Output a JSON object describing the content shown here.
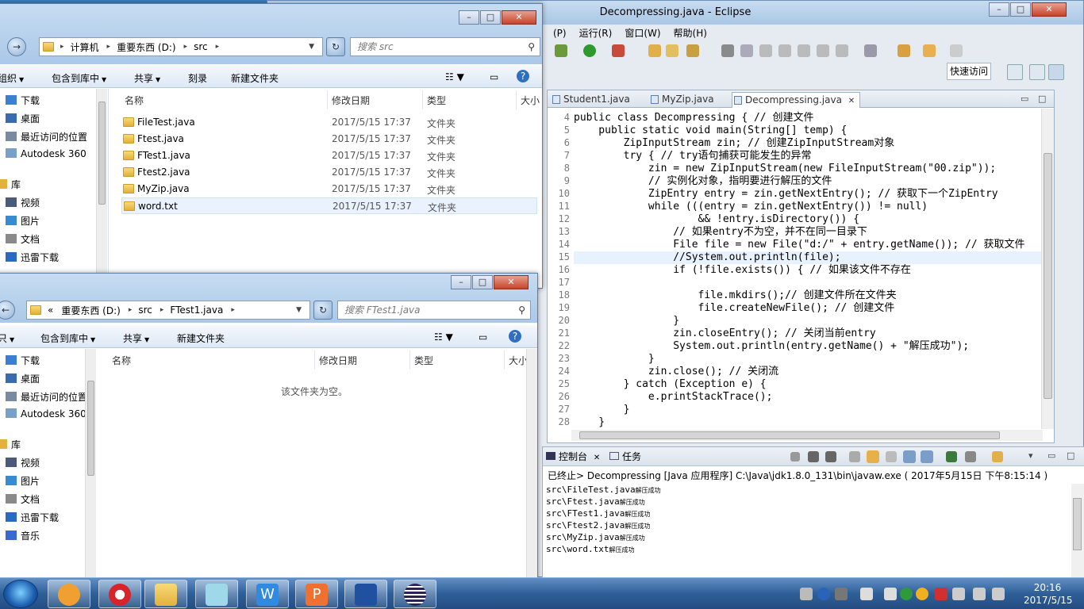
{
  "eclipse": {
    "title": "Decompressing.java - Eclipse",
    "menu": [
      "(P)",
      "运行(R)",
      "窗口(W)",
      "帮助(H)"
    ],
    "quick_access": "快速访问",
    "editor_tabs": [
      "Student1.java",
      "MyZip.java",
      "Decompressing.java"
    ],
    "line_numbers": [
      "4",
      "5",
      "6",
      "7",
      "8",
      "9",
      "10",
      "11",
      "12",
      "13",
      "14",
      "15",
      "16",
      "17",
      "18",
      "19",
      "20",
      "21",
      "22",
      "23",
      "24",
      "25",
      "26",
      "27",
      "28"
    ],
    "code_lines": [
      "public class Decompressing { // 创建文件",
      "    public static void main(String[] temp) {",
      "        ZipInputStream zin; // 创建ZipInputStream对象",
      "        try { // try语句捕获可能发生的异常",
      "            zin = new ZipInputStream(new FileInputStream(\"00.zip\"));",
      "            // 实例化对象，指明要进行解压的文件",
      "            ZipEntry entry = zin.getNextEntry(); // 获取下一个ZipEntry",
      "            while (((entry = zin.getNextEntry()) != null)",
      "                    && !entry.isDirectory()) {",
      "                // 如果entry不为空，并不在同一目录下",
      "                File file = new File(\"d:/\" + entry.getName()); // 获取文件",
      "                //System.out.println(file);",
      "                if (!file.exists()) { // 如果该文件不存在",
      "",
      "                    file.mkdirs();// 创建文件所在文件夹",
      "                    file.createNewFile(); // 创建文件",
      "                }",
      "                zin.closeEntry(); // 关闭当前entry",
      "                System.out.println(entry.getName() + \"解压成功\");",
      "            }",
      "            zin.close(); // 关闭流",
      "        } catch (Exception e) {",
      "            e.printStackTrace();",
      "        }",
      "    }"
    ],
    "console": {
      "tabs": [
        "控制台",
        "任务"
      ],
      "header": "已终止> Decompressing [Java 应用程序] C:\\Java\\jdk1.8.0_131\\bin\\javaw.exe ( 2017年5月15日 下午8:15:14 )",
      "lines": [
        {
          "path": "src\\FileTest.java",
          "msg": "解压成功"
        },
        {
          "path": "src\\Ftest.java",
          "msg": "解压成功"
        },
        {
          "path": "src\\FTest1.java",
          "msg": "解压成功"
        },
        {
          "path": "src\\Ftest2.java",
          "msg": "解压成功"
        },
        {
          "path": "src\\MyZip.java",
          "msg": "解压成功"
        },
        {
          "path": "src\\word.txt",
          "msg": "解压成功"
        }
      ]
    }
  },
  "explorer1": {
    "address": [
      "计算机",
      "重要东西 (D:)",
      "src"
    ],
    "search_placeholder": "搜索 src",
    "commands": [
      "组织",
      "包含到库中",
      "共享",
      "刻录",
      "新建文件夹"
    ],
    "nav": [
      "下载",
      "桌面",
      "最近访问的位置",
      "Autodesk 360",
      "库",
      "视频",
      "图片",
      "文档",
      "迅雷下载"
    ],
    "columns": [
      "名称",
      "修改日期",
      "类型",
      "大小"
    ],
    "files": [
      {
        "name": "FileTest.java",
        "date": "2017/5/15 17:37",
        "type": "文件夹"
      },
      {
        "name": "Ftest.java",
        "date": "2017/5/15 17:37",
        "type": "文件夹"
      },
      {
        "name": "FTest1.java",
        "date": "2017/5/15 17:37",
        "type": "文件夹"
      },
      {
        "name": "Ftest2.java",
        "date": "2017/5/15 17:37",
        "type": "文件夹"
      },
      {
        "name": "MyZip.java",
        "date": "2017/5/15 17:37",
        "type": "文件夹"
      },
      {
        "name": "word.txt",
        "date": "2017/5/15 17:37",
        "type": "文件夹"
      }
    ]
  },
  "explorer2": {
    "address": [
      "«",
      "重要东西 (D:)",
      "src",
      "FTest1.java"
    ],
    "search_placeholder": "搜索 FTest1.java",
    "commands": [
      "只",
      "包含到库中",
      "共享",
      "新建文件夹"
    ],
    "nav": [
      "下载",
      "桌面",
      "最近访问的位置",
      "Autodesk 360",
      "库",
      "视频",
      "图片",
      "文档",
      "迅雷下载",
      "音乐"
    ],
    "columns": [
      "名称",
      "修改日期",
      "类型",
      "大小"
    ],
    "empty_message": "该文件夹为空。"
  },
  "taskbar": {
    "clock_time": "20:16",
    "clock_date": "2017/5/15"
  }
}
